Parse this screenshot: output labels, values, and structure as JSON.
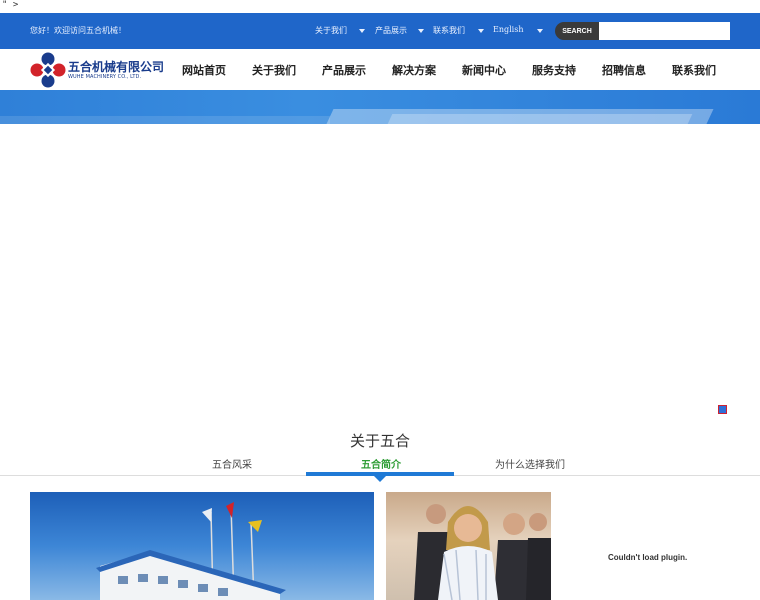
{
  "stray_text": "\" >",
  "topbar": {
    "welcome": "您好！欢迎访问五合机械！",
    "links": [
      "关于我们",
      "产品展示",
      "联系我们",
      "English"
    ],
    "search_label": "SEARCH",
    "search_value": ""
  },
  "logo": {
    "name_cn": "五合机械有限公司",
    "name_en": "WUHE MACHINERY CO., LTD."
  },
  "nav": {
    "items": [
      "网站首页",
      "关于我们",
      "产品展示",
      "解决方案",
      "新闻中心",
      "服务支持",
      "招聘信息",
      "联系我们"
    ]
  },
  "about": {
    "title": "关于五合",
    "tabs": [
      "五合风采",
      "五合简介",
      "为什么选择我们"
    ],
    "active_tab": "五合简介"
  },
  "plugin_message": "Couldn't load plugin.",
  "colors": {
    "topbar": "#1f66c9",
    "accent_green": "#2e9d35",
    "accent_blue": "#1f7ad6"
  }
}
